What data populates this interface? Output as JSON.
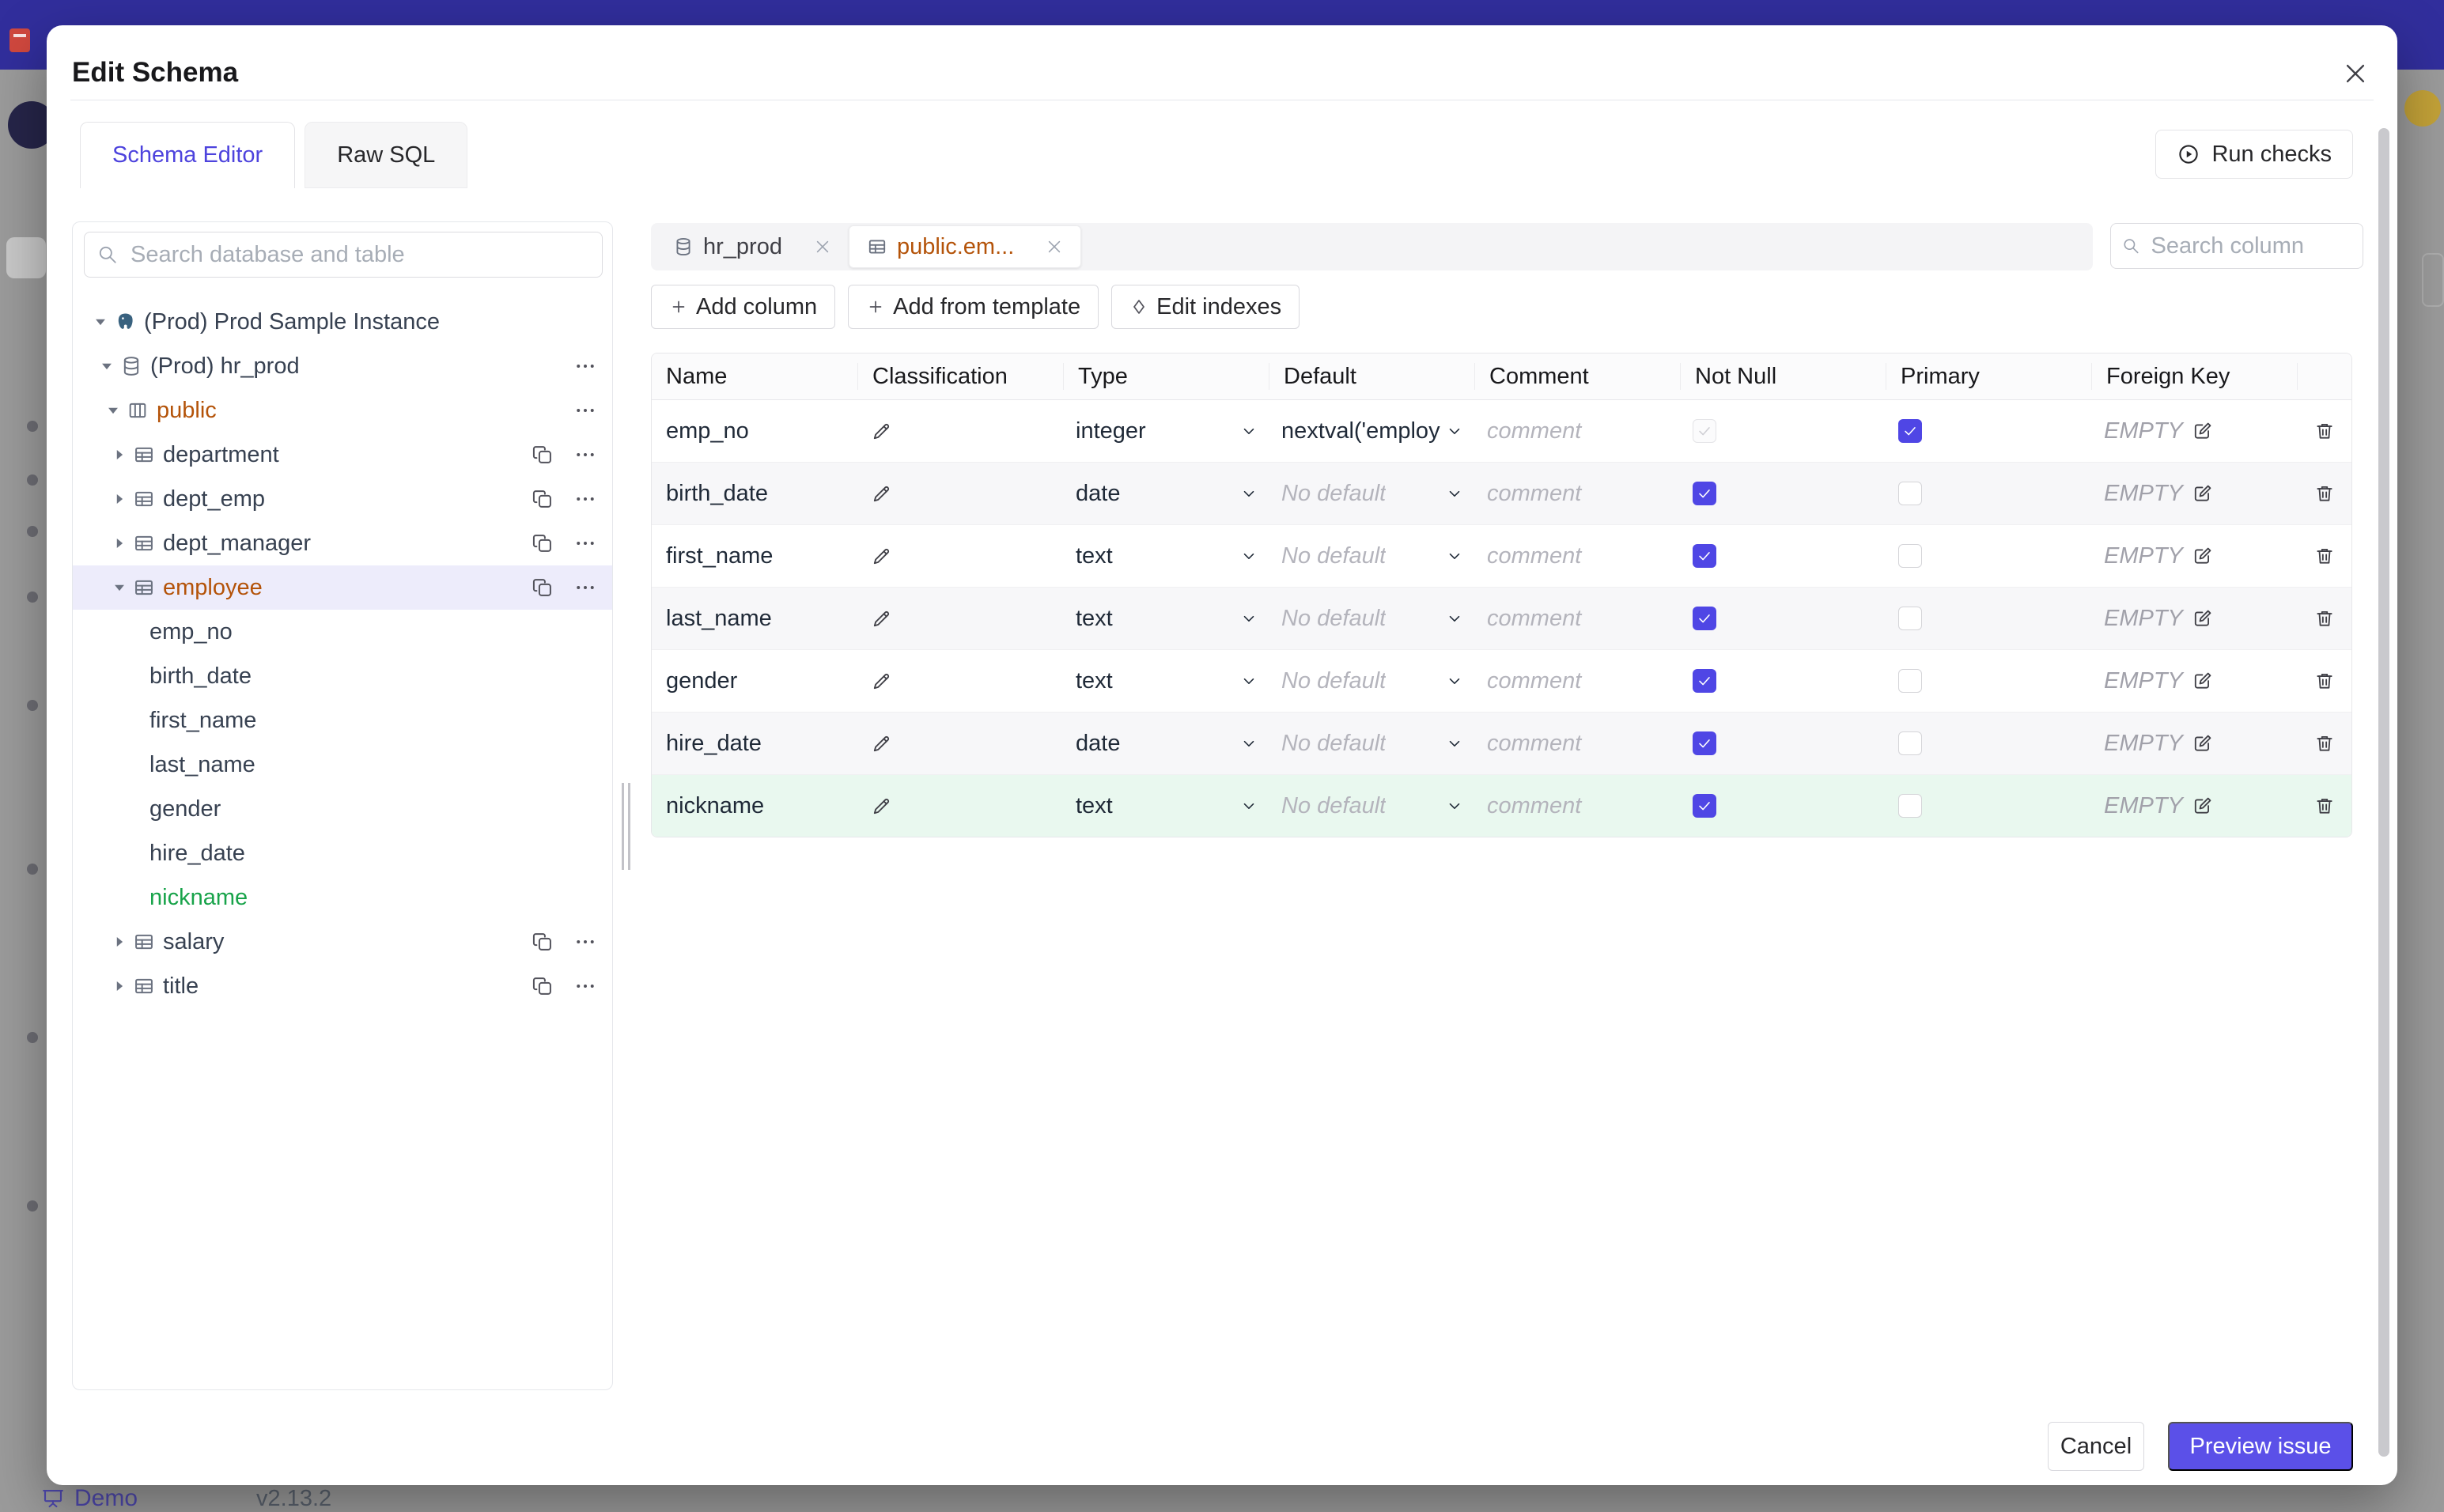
{
  "modal": {
    "title": "Edit Schema",
    "tabs": [
      {
        "label": "Schema Editor",
        "active": true
      },
      {
        "label": "Raw SQL",
        "active": false
      }
    ],
    "run_checks_label": "Run checks",
    "cancel_label": "Cancel",
    "preview_label": "Preview issue"
  },
  "sidebar": {
    "search_placeholder": "Search database and table",
    "tree": [
      {
        "kind": "instance",
        "icon": "postgres",
        "label": "(Prod) Prod Sample Instance",
        "expanded": true
      },
      {
        "kind": "database",
        "icon": "database",
        "label": "(Prod) hr_prod",
        "expanded": true,
        "more": true
      },
      {
        "kind": "schema",
        "icon": "schema",
        "label": "public",
        "expanded": true,
        "more": true,
        "color": "orange"
      },
      {
        "kind": "table",
        "icon": "table",
        "label": "department",
        "expanded": false,
        "copy": true,
        "more": true
      },
      {
        "kind": "table",
        "icon": "table",
        "label": "dept_emp",
        "expanded": false,
        "copy": true,
        "more": true
      },
      {
        "kind": "table",
        "icon": "table",
        "label": "dept_manager",
        "expanded": false,
        "copy": true,
        "more": true
      },
      {
        "kind": "table",
        "icon": "table",
        "label": "employee",
        "expanded": true,
        "copy": true,
        "more": true,
        "selected": true,
        "color": "orange"
      },
      {
        "kind": "column",
        "label": "emp_no"
      },
      {
        "kind": "column",
        "label": "birth_date"
      },
      {
        "kind": "column",
        "label": "first_name"
      },
      {
        "kind": "column",
        "label": "last_name"
      },
      {
        "kind": "column",
        "label": "gender"
      },
      {
        "kind": "column",
        "label": "hire_date"
      },
      {
        "kind": "column",
        "label": "nickname",
        "color": "green"
      },
      {
        "kind": "table",
        "icon": "table",
        "label": "salary",
        "expanded": false,
        "copy": true,
        "more": true
      },
      {
        "kind": "table",
        "icon": "table",
        "label": "title",
        "expanded": false,
        "copy": true,
        "more": true
      }
    ]
  },
  "editor": {
    "tabs": [
      {
        "icon": "database",
        "label": "hr_prod",
        "active": false
      },
      {
        "icon": "table",
        "label": "public.em...",
        "active": true
      }
    ],
    "column_search_placeholder": "Search column",
    "actions": [
      {
        "icon": "plus",
        "label": "Add column"
      },
      {
        "icon": "plus",
        "label": "Add from template"
      },
      {
        "icon": "diamond",
        "label": "Edit indexes"
      }
    ],
    "grid": {
      "headers": [
        "Name",
        "Classification",
        "Type",
        "Default",
        "Comment",
        "Not Null",
        "Primary",
        "Foreign Key"
      ],
      "comment_placeholder": "comment",
      "foreign_key_empty": "EMPTY",
      "rows": [
        {
          "name": "emp_no",
          "type": "integer",
          "default": "nextval('employ",
          "default_is_placeholder": false,
          "not_null": "disabled-checked",
          "primary": true,
          "bg": "white"
        },
        {
          "name": "birth_date",
          "type": "date",
          "default": "No default",
          "default_is_placeholder": true,
          "not_null": "checked",
          "primary": false,
          "bg": "alt"
        },
        {
          "name": "first_name",
          "type": "text",
          "default": "No default",
          "default_is_placeholder": true,
          "not_null": "checked",
          "primary": false,
          "bg": "white"
        },
        {
          "name": "last_name",
          "type": "text",
          "default": "No default",
          "default_is_placeholder": true,
          "not_null": "checked",
          "primary": false,
          "bg": "alt"
        },
        {
          "name": "gender",
          "type": "text",
          "default": "No default",
          "default_is_placeholder": true,
          "not_null": "checked",
          "primary": false,
          "bg": "white"
        },
        {
          "name": "hire_date",
          "type": "date",
          "default": "No default",
          "default_is_placeholder": true,
          "not_null": "checked",
          "primary": false,
          "bg": "alt"
        },
        {
          "name": "nickname",
          "type": "text",
          "default": "No default",
          "default_is_placeholder": true,
          "not_null": "checked",
          "primary": false,
          "bg": "green"
        }
      ]
    }
  },
  "background": {
    "demo_label": "Demo",
    "version": "v2.13.2"
  },
  "colors": {
    "accent": "#4f46e5",
    "primary_button": "#5b50e8",
    "changed_orange": "#b45309",
    "added_green": "#18a34a",
    "added_row_bg": "#e9f8ef",
    "selected_tree_bg": "#edecfb",
    "topbar_blue": "#312e9c"
  }
}
